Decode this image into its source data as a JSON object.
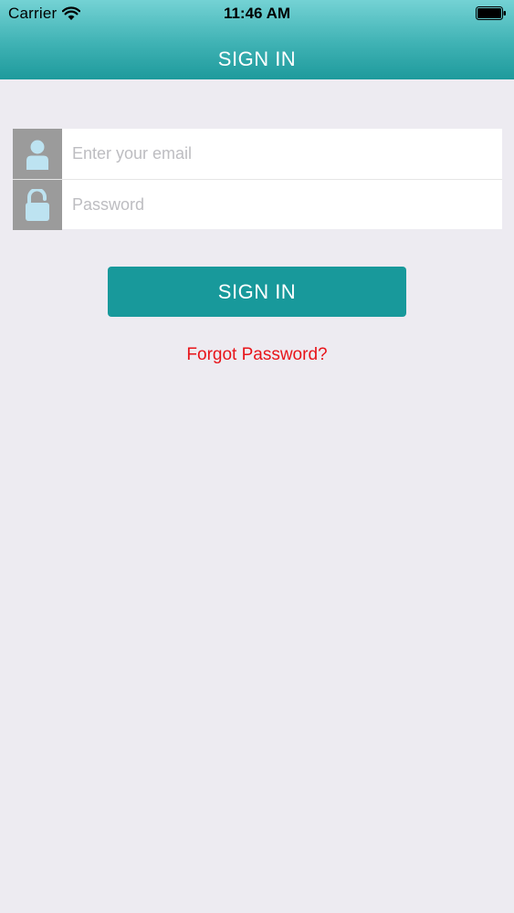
{
  "status_bar": {
    "carrier": "Carrier",
    "time": "11:46 AM",
    "icons": [
      "wifi-icon",
      "battery-icon"
    ]
  },
  "nav": {
    "title": "SIGN IN"
  },
  "form": {
    "email": {
      "placeholder": "Enter your email",
      "value": "",
      "icon": "user-icon"
    },
    "password": {
      "placeholder": "Password",
      "value": "",
      "icon": "unlock-icon"
    }
  },
  "actions": {
    "signin_label": "SIGN IN",
    "forgot_label": "Forgot Password?"
  },
  "colors": {
    "header_top": "#74D2D4",
    "header_bottom": "#1E9A9C",
    "button": "#18999B",
    "icon_bg": "#9B9B9B",
    "icon_glyph": "#BDE3F1",
    "forgot_text": "#E8141A",
    "background": "#EDEBF1"
  }
}
